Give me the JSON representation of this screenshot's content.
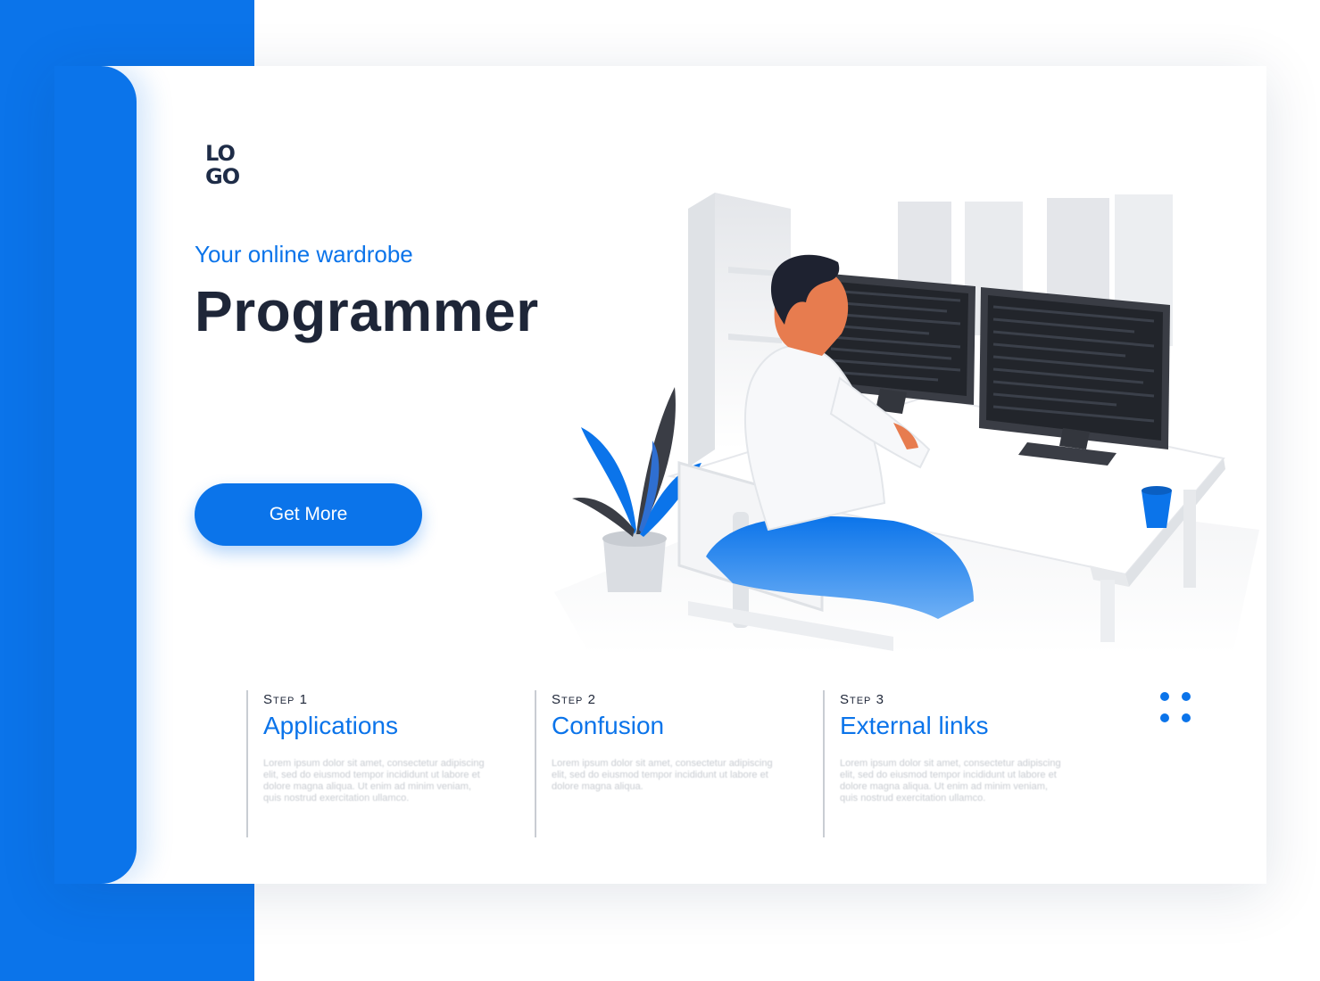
{
  "brand": {
    "logo_line1": "LO",
    "logo_line2": "GO",
    "accent_color": "#0b74ea",
    "dark_color": "#1e2638"
  },
  "hero": {
    "subtitle": "Your online wardrobe",
    "title": "Programmer",
    "cta_label": "Get More",
    "illustration": "programmer-at-desk-illustration"
  },
  "steps": [
    {
      "label": "Step 1",
      "title": "Applications",
      "text": "Lorem ipsum dolor sit amet, consectetur adipiscing elit, sed do eiusmod tempor incididunt ut labore et dolore magna aliqua. Ut enim ad minim veniam, quis nostrud exercitation ullamco."
    },
    {
      "label": "Step 2",
      "title": "Confusion",
      "text": "Lorem ipsum dolor sit amet, consectetur adipiscing elit, sed do eiusmod tempor incididunt ut labore et dolore magna aliqua."
    },
    {
      "label": "Step 3",
      "title": "External links",
      "text": "Lorem ipsum dolor sit amet, consectetur adipiscing elit, sed do eiusmod tempor incididunt ut labore et dolore magna aliqua. Ut enim ad minim veniam, quis nostrud exercitation ullamco."
    }
  ],
  "pagination_icon": "four-dots-icon"
}
